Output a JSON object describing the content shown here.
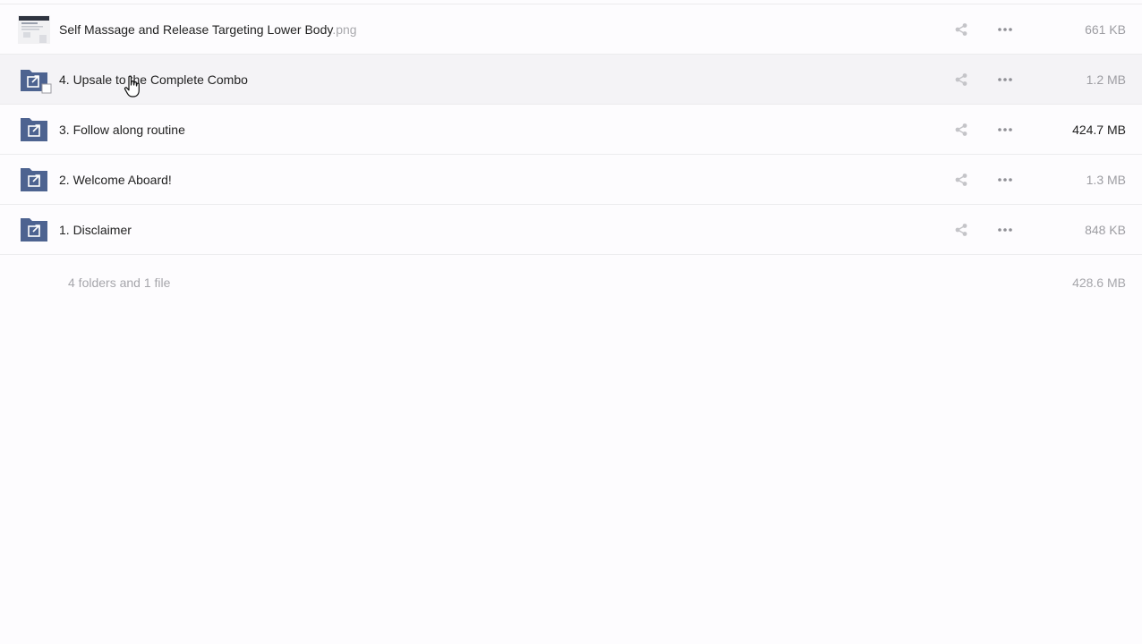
{
  "rows": [
    {
      "name": "Self Massage and Release Targeting Lower Body",
      "ext": ".png",
      "size": "661 KB",
      "icon": "image-thumbnail"
    },
    {
      "name": "4. Upsale to the Complete Combo",
      "ext": "",
      "size": "1.2 MB",
      "icon": "shared-folder-icon"
    },
    {
      "name": "3. Follow along routine",
      "ext": "",
      "size": "424.7 MB",
      "icon": "shared-folder-icon"
    },
    {
      "name": "2. Welcome Aboard!",
      "ext": "",
      "size": "1.3 MB",
      "icon": "shared-folder-icon"
    },
    {
      "name": "1. Disclaimer",
      "ext": "",
      "size": "848 KB",
      "icon": "shared-folder-icon"
    }
  ],
  "summary": {
    "text": "4 folders and 1 file",
    "total_size": "428.6 MB"
  },
  "colors": {
    "folder": "#4d6390",
    "icon_gray": "#b9b9be",
    "hover_row": "#f4f3f6"
  }
}
